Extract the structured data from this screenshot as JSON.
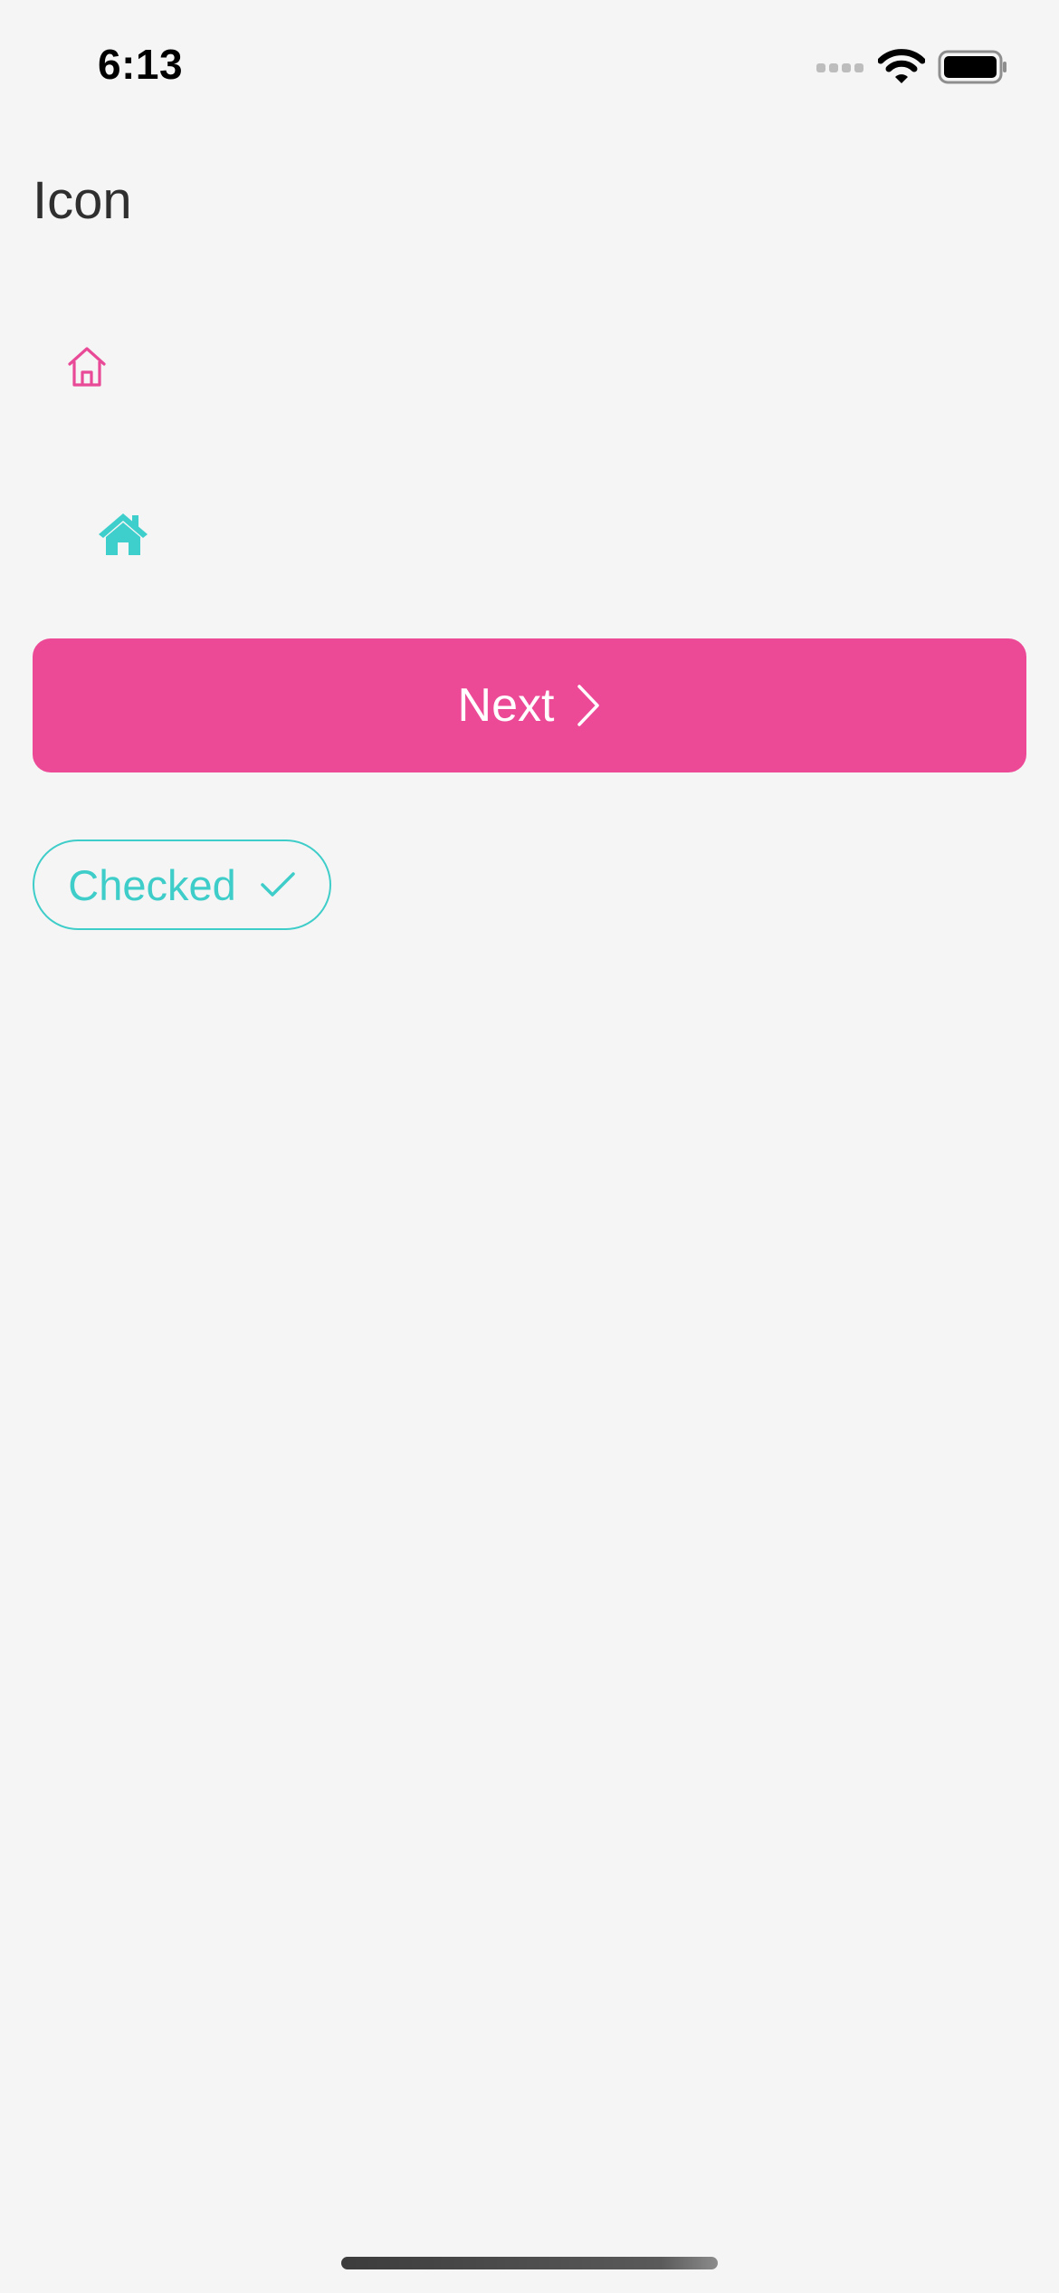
{
  "status_bar": {
    "time": "6:13"
  },
  "header": {
    "title": "Icon"
  },
  "icons": {
    "outline_home": {
      "name": "home-outline-icon",
      "color": "#e94a97"
    },
    "filled_home": {
      "name": "home-filled-icon",
      "color": "#3ecfcc"
    }
  },
  "buttons": {
    "next": {
      "label": "Next",
      "icon": "chevron-right-icon",
      "background": "#ec4a97",
      "text_color": "#ffffff"
    },
    "checked": {
      "label": "Checked",
      "icon": "checkmark-icon",
      "color": "#3ecdc9"
    }
  }
}
